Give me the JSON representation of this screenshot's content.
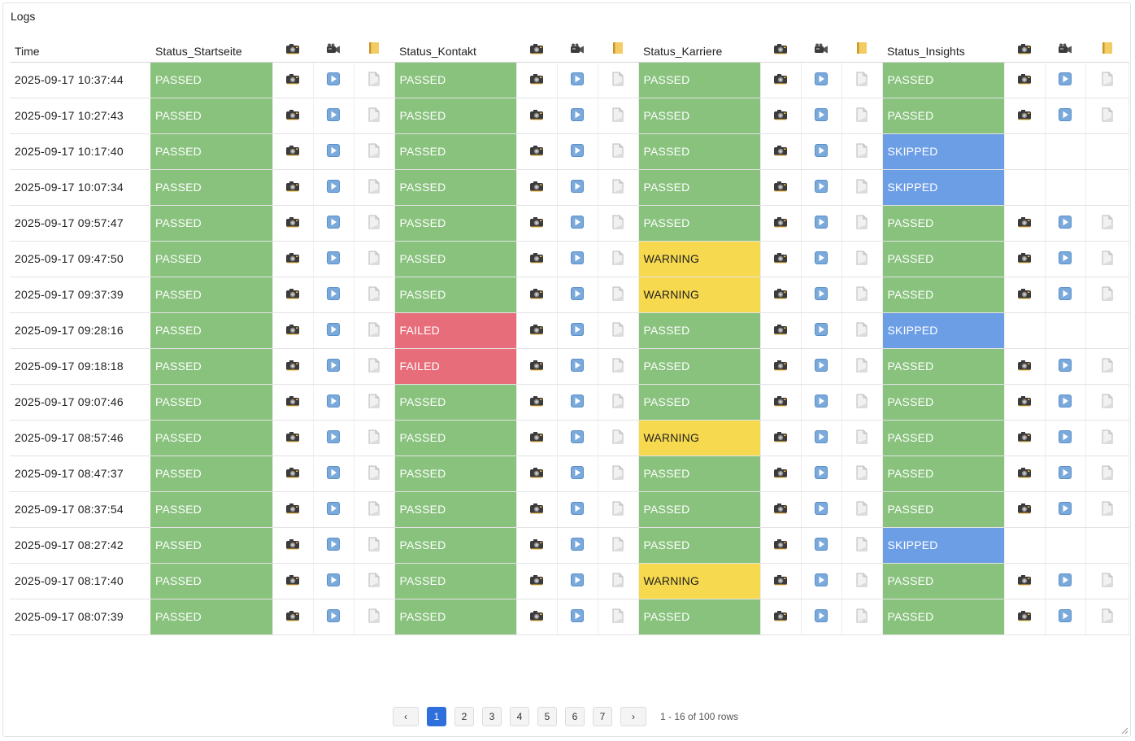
{
  "panel": {
    "title": "Logs"
  },
  "columns": {
    "time": "Time",
    "groups": [
      "Status_Startseite",
      "Status_Kontakt",
      "Status_Karriere",
      "Status_Insights"
    ]
  },
  "icons": {
    "screenshot": "camera-icon",
    "video": "play-icon",
    "header_video": "video-camera-icon",
    "header_log": "notebook-icon",
    "log": "document-icon"
  },
  "colors": {
    "PASSED": "#88c27d",
    "FAILED": "#e86d7a",
    "WARNING": "#f6d94f",
    "SKIPPED": "#6c9ee6",
    "active_page": "#2f6fdc"
  },
  "rows": [
    {
      "time": "2025-09-17 10:37:44",
      "statuses": [
        "PASSED",
        "PASSED",
        "PASSED",
        "PASSED"
      ]
    },
    {
      "time": "2025-09-17 10:27:43",
      "statuses": [
        "PASSED",
        "PASSED",
        "PASSED",
        "PASSED"
      ]
    },
    {
      "time": "2025-09-17 10:17:40",
      "statuses": [
        "PASSED",
        "PASSED",
        "PASSED",
        "SKIPPED"
      ]
    },
    {
      "time": "2025-09-17 10:07:34",
      "statuses": [
        "PASSED",
        "PASSED",
        "PASSED",
        "SKIPPED"
      ]
    },
    {
      "time": "2025-09-17 09:57:47",
      "statuses": [
        "PASSED",
        "PASSED",
        "PASSED",
        "PASSED"
      ]
    },
    {
      "time": "2025-09-17 09:47:50",
      "statuses": [
        "PASSED",
        "PASSED",
        "WARNING",
        "PASSED"
      ]
    },
    {
      "time": "2025-09-17 09:37:39",
      "statuses": [
        "PASSED",
        "PASSED",
        "WARNING",
        "PASSED"
      ]
    },
    {
      "time": "2025-09-17 09:28:16",
      "statuses": [
        "PASSED",
        "FAILED",
        "PASSED",
        "SKIPPED"
      ]
    },
    {
      "time": "2025-09-17 09:18:18",
      "statuses": [
        "PASSED",
        "FAILED",
        "PASSED",
        "PASSED"
      ]
    },
    {
      "time": "2025-09-17 09:07:46",
      "statuses": [
        "PASSED",
        "PASSED",
        "PASSED",
        "PASSED"
      ]
    },
    {
      "time": "2025-09-17 08:57:46",
      "statuses": [
        "PASSED",
        "PASSED",
        "WARNING",
        "PASSED"
      ]
    },
    {
      "time": "2025-09-17 08:47:37",
      "statuses": [
        "PASSED",
        "PASSED",
        "PASSED",
        "PASSED"
      ]
    },
    {
      "time": "2025-09-17 08:37:54",
      "statuses": [
        "PASSED",
        "PASSED",
        "PASSED",
        "PASSED"
      ]
    },
    {
      "time": "2025-09-17 08:27:42",
      "statuses": [
        "PASSED",
        "PASSED",
        "PASSED",
        "SKIPPED"
      ]
    },
    {
      "time": "2025-09-17 08:17:40",
      "statuses": [
        "PASSED",
        "PASSED",
        "WARNING",
        "PASSED"
      ]
    },
    {
      "time": "2025-09-17 08:07:39",
      "statuses": [
        "PASSED",
        "PASSED",
        "PASSED",
        "PASSED"
      ]
    }
  ],
  "pagination": {
    "prev": "‹",
    "next": "›",
    "pages": [
      "1",
      "2",
      "3",
      "4",
      "5",
      "6",
      "7"
    ],
    "current": "1",
    "info": "1 - 16 of 100 rows"
  }
}
